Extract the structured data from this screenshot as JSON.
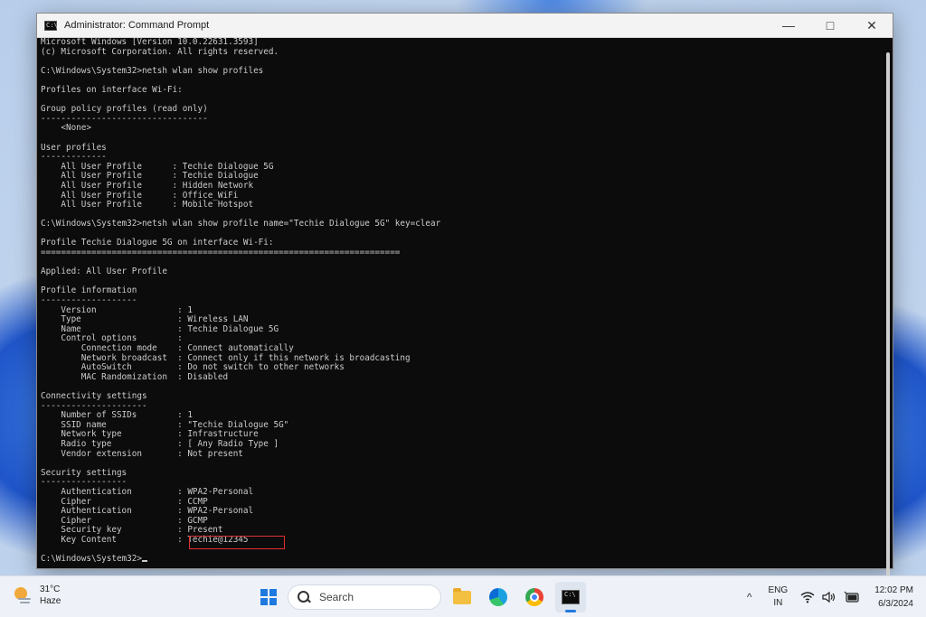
{
  "window": {
    "title": "Administrator: Command Prompt",
    "app_icon_text": "C:\\",
    "controls": {
      "minimize": "—",
      "maximize": "□",
      "close": "✕"
    }
  },
  "console": {
    "text": "Microsoft Windows [Version 10.0.22631.3593]\n(c) Microsoft Corporation. All rights reserved.\n\nC:\\Windows\\System32>netsh wlan show profiles\n\nProfiles on interface Wi-Fi:\n\nGroup policy profiles (read only)\n---------------------------------\n    <None>\n\nUser profiles\n-------------\n    All User Profile      : Techie Dialogue 5G\n    All User Profile      : Techie Dialogue\n    All User Profile      : Hidden Network\n    All User Profile      : Office_WiFi\n    All User Profile      : Mobile Hotspot\n\nC:\\Windows\\System32>netsh wlan show profile name=\"Techie Dialogue 5G\" key=clear\n\nProfile Techie Dialogue 5G on interface Wi-Fi:\n=======================================================================\n\nApplied: All User Profile\n\nProfile information\n-------------------\n    Version                : 1\n    Type                   : Wireless LAN\n    Name                   : Techie Dialogue 5G\n    Control options        :\n        Connection mode    : Connect automatically\n        Network broadcast  : Connect only if this network is broadcasting\n        AutoSwitch         : Do not switch to other networks\n        MAC Randomization  : Disabled\n\nConnectivity settings\n---------------------\n    Number of SSIDs        : 1\n    SSID name              : \"Techie Dialogue 5G\"\n    Network type           : Infrastructure\n    Radio type             : [ Any Radio Type ]\n    Vendor extension       : Not present\n\nSecurity settings\n-----------------\n    Authentication         : WPA2-Personal\n    Cipher                 : CCMP\n    Authentication         : WPA2-Personal\n    Cipher                 : GCMP\n    Security key           : Present\n    Key Content            : Techie@12345\n\nC:\\Windows\\System32>",
    "highlight_color": "#e03030"
  },
  "taskbar": {
    "weather": {
      "temp": "31°C",
      "condition": "Haze"
    },
    "search_label": "Search",
    "tray": {
      "chevron": "^",
      "lang_line1": "ENG",
      "lang_line2": "IN",
      "time": "12:02 PM",
      "date": "6/3/2024"
    }
  }
}
